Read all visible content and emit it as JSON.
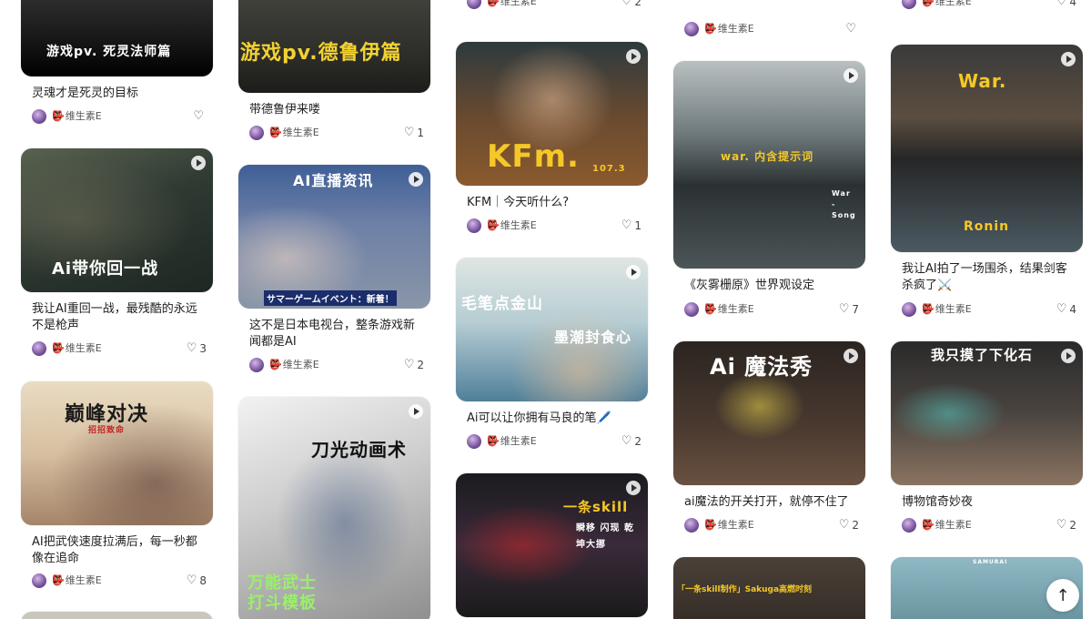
{
  "columns": [
    {
      "cards": [
        {
          "title": "灵魂才是死灵的目标",
          "overlay": "游戏pv. 死灵法师篇",
          "author": "维生素E",
          "likes": ""
        },
        {
          "title": "我让AI重回一战，最残酷的永远不是枪声",
          "overlay": "Ai带你回一战",
          "author": "维生素E",
          "likes": "3"
        },
        {
          "title": "AI把武侠速度拉满后，每一秒都像在追命",
          "overlay": "巅峰对决",
          "overlay2": "招招致命",
          "author": "维生素E",
          "likes": "8"
        }
      ]
    },
    {
      "cards": [
        {
          "title": "带德鲁伊来喽",
          "overlay": "游戏pv.德鲁伊篇",
          "author": "维生素E",
          "likes": "1"
        },
        {
          "title": "这不是日本电视台，整条游戏新闻都是AI",
          "overlay": "AI直播资讯",
          "overlay2": "サマーゲームイベント：新着！",
          "author": "维生素E",
          "likes": "2"
        },
        {
          "title": "",
          "overlay": "刀光动画术",
          "overlay2": "万能武士\n打斗模板",
          "author": "",
          "likes": ""
        }
      ]
    },
    {
      "cards": [
        {
          "title": "",
          "overlay": "",
          "author": "维生素E",
          "likes": "2"
        },
        {
          "title": "KFM｜今天听什么?",
          "overlay": "KFm.",
          "overlay2": "107.3",
          "author": "维生素E",
          "likes": "1"
        },
        {
          "title": "Ai可以让你拥有马良的笔🖊️",
          "overlay": "毛笔点金山",
          "overlay2": "墨潮封食心",
          "author": "维生素E",
          "likes": "2"
        },
        {
          "title": "",
          "overlay": "一条skill",
          "overlay2": "瞬移 闪现 乾坤大挪",
          "author": "",
          "likes": ""
        }
      ]
    },
    {
      "cards": [
        {
          "title": "",
          "overlay": "",
          "author": "维生素E",
          "likes": ""
        },
        {
          "title": "《灰雾栅原》世界观设定",
          "overlay": "war. 内含提示词",
          "overlay2": "War - Song",
          "author": "维生素E",
          "likes": "7"
        },
        {
          "title": "ai魔法的开关打开，就停不住了",
          "overlay": "Ai 魔法秀",
          "author": "维生素E",
          "likes": "2"
        },
        {
          "title": "",
          "overlay": "「一条skill制作」Sakuga高燃时刻",
          "author": "",
          "likes": ""
        }
      ]
    },
    {
      "cards": [
        {
          "title": "",
          "overlay": "",
          "author": "维生素E",
          "likes": "4"
        },
        {
          "title": "我让AI拍了一场围杀，结果剑客杀疯了⚔️",
          "overlay": "War.",
          "overlay2": "Ronin",
          "author": "维生素E",
          "likes": "4"
        },
        {
          "title": "博物馆奇妙夜",
          "overlay": "我只摸了下化石",
          "author": "维生素E",
          "likes": "2"
        },
        {
          "title": "",
          "overlay": "SAMURAI",
          "author": "",
          "likes": ""
        }
      ]
    }
  ],
  "icons": {
    "heart": "heart-outline-icon",
    "play": "play-icon",
    "avatar": "avatar",
    "author_badge": "red-mask-icon",
    "scroll_top": "arrow-up-icon"
  },
  "scroll_top": {
    "label": "↑"
  },
  "colors": {
    "bg": "#ffffff",
    "text": "#222222",
    "muted": "#555555",
    "accent_red": "#d83a3a"
  }
}
